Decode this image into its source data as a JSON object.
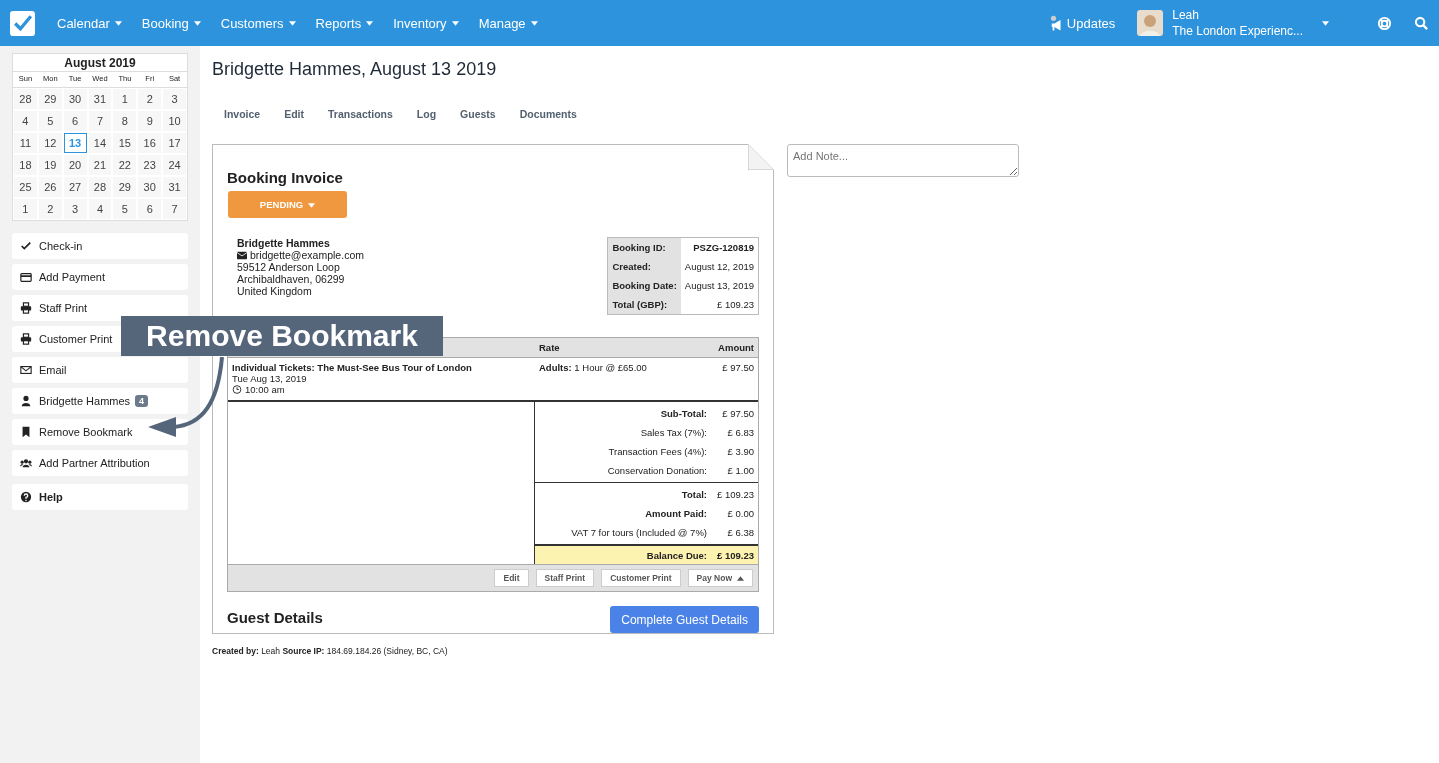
{
  "nav": {
    "menus": [
      "Calendar",
      "Booking",
      "Customers",
      "Reports",
      "Inventory",
      "Manage"
    ],
    "updates": "Updates",
    "user": {
      "name": "Leah",
      "company": "The London Experienc..."
    }
  },
  "calendar": {
    "title": "August 2019",
    "weekdays": [
      "Sun",
      "Mon",
      "Tue",
      "Wed",
      "Thu",
      "Fri",
      "Sat"
    ],
    "weeks": [
      [
        {
          "day": "28",
          "selected": false
        },
        {
          "day": "29",
          "selected": false
        },
        {
          "day": "30",
          "selected": false
        },
        {
          "day": "31",
          "selected": false
        },
        {
          "day": "1",
          "selected": false
        },
        {
          "day": "2",
          "selected": false
        },
        {
          "day": "3",
          "selected": false
        }
      ],
      [
        {
          "day": "4",
          "selected": false
        },
        {
          "day": "5",
          "selected": false
        },
        {
          "day": "6",
          "selected": false
        },
        {
          "day": "7",
          "selected": false
        },
        {
          "day": "8",
          "selected": false
        },
        {
          "day": "9",
          "selected": false
        },
        {
          "day": "10",
          "selected": false
        }
      ],
      [
        {
          "day": "11",
          "selected": false
        },
        {
          "day": "12",
          "selected": false
        },
        {
          "day": "13",
          "selected": true
        },
        {
          "day": "14",
          "selected": false
        },
        {
          "day": "15",
          "selected": false
        },
        {
          "day": "16",
          "selected": false
        },
        {
          "day": "17",
          "selected": false
        }
      ],
      [
        {
          "day": "18",
          "selected": false
        },
        {
          "day": "19",
          "selected": false
        },
        {
          "day": "20",
          "selected": false
        },
        {
          "day": "21",
          "selected": false
        },
        {
          "day": "22",
          "selected": false
        },
        {
          "day": "23",
          "selected": false
        },
        {
          "day": "24",
          "selected": false
        }
      ],
      [
        {
          "day": "25",
          "selected": false
        },
        {
          "day": "26",
          "selected": false
        },
        {
          "day": "27",
          "selected": false
        },
        {
          "day": "28",
          "selected": false
        },
        {
          "day": "29",
          "selected": false
        },
        {
          "day": "30",
          "selected": false
        },
        {
          "day": "31",
          "selected": false
        }
      ],
      [
        {
          "day": "1",
          "selected": false
        },
        {
          "day": "2",
          "selected": false
        },
        {
          "day": "3",
          "selected": false
        },
        {
          "day": "4",
          "selected": false
        },
        {
          "day": "5",
          "selected": false
        },
        {
          "day": "6",
          "selected": false
        },
        {
          "day": "7",
          "selected": false
        }
      ]
    ]
  },
  "actions": [
    {
      "kind": "check",
      "label": "Check-in"
    },
    {
      "kind": "card",
      "label": "Add Payment"
    },
    {
      "kind": "print",
      "label": "Staff Print"
    },
    {
      "kind": "print",
      "label": "Customer Print"
    },
    {
      "kind": "mail",
      "label": "Email"
    },
    {
      "kind": "person",
      "label": "Bridgette Hammes",
      "badge": "4"
    },
    {
      "kind": "bookmark",
      "label": "Remove Bookmark"
    },
    {
      "kind": "group",
      "label": "Add Partner Attribution"
    }
  ],
  "help": "Help",
  "page_title": "Bridgette Hammes, August 13 2019",
  "tabs": [
    "Invoice",
    "Edit",
    "Transactions",
    "Log",
    "Guests",
    "Documents"
  ],
  "note": {
    "placeholder": "Add Note..."
  },
  "invoice": {
    "title": "Booking Invoice",
    "status": "PENDING",
    "customer": {
      "name": "Bridgette Hammes",
      "email": "bridgette@example.com",
      "address": [
        "59512 Anderson Loop",
        "Archibaldhaven, 06299",
        "United Kingdom"
      ]
    },
    "summary": [
      {
        "label": "Booking ID:",
        "value": "PSZG-120819",
        "bold": true
      },
      {
        "label": "Created:",
        "value": "August 12, 2019",
        "bold": false
      },
      {
        "label": "Booking Date:",
        "value": "August 13, 2019",
        "bold": false
      },
      {
        "label": "Total (GBP):",
        "value": "£ 109.23",
        "bold": false
      }
    ],
    "columns": [
      "Rate",
      "Amount"
    ],
    "item": {
      "name": "Individual Tickets: The Must-See Bus Tour of London",
      "date": "Tue Aug 13, 2019",
      "time": "10:00 am",
      "rate_label": "Adults:",
      "rate": "1 Hour @ £65.00",
      "amount": "£ 97.50"
    },
    "totals": [
      [
        {
          "label": "Sub-Total:",
          "value": "£ 97.50",
          "bold": true
        },
        {
          "label": "Sales Tax (7%):",
          "value": "£ 6.83",
          "bold": false
        },
        {
          "label": "Transaction Fees (4%):",
          "value": "£ 3.90",
          "bold": false
        },
        {
          "label": "Conservation Donation:",
          "value": "£ 1.00",
          "bold": false
        }
      ],
      [
        {
          "label": "Total:",
          "value": "£ 109.23",
          "bold": true
        },
        {
          "label": "Amount Paid:",
          "value": "£ 0.00",
          "bold": true
        },
        {
          "label": "VAT 7 for tours (Included @ 7%)",
          "value": "£ 6.38",
          "bold": false
        }
      ]
    ],
    "balance": {
      "label": "Balance Due:",
      "value": "£ 109.23"
    },
    "buttons": [
      "Edit",
      "Staff Print",
      "Customer Print",
      "Pay Now"
    ],
    "guest_title": "Guest Details",
    "guest_button": "Complete Guest Details"
  },
  "footer": {
    "created_label": "Created by:",
    "created": "Leah",
    "ip_label": "Source IP:",
    "ip": "184.69.184.26 (Sidney, BC, CA)"
  },
  "callout": "Remove Bookmark"
}
